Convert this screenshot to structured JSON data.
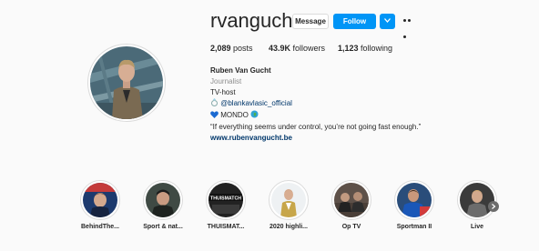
{
  "profile": {
    "username": "rvangucht",
    "buttons": {
      "message": "Message",
      "follow": "Follow"
    },
    "stats": {
      "posts_value": "2,089",
      "posts_label": "posts",
      "followers_value": "43.9K",
      "followers_label": "followers",
      "following_value": "1,123",
      "following_label": "following"
    },
    "bio": {
      "name": "Ruben Van Gucht",
      "category": "Journalist",
      "line1": "TV-host",
      "mention": "@blankavlasic_official",
      "line3": "MONDO",
      "quote": "“If everything seems under control, you’re not going fast enough.”",
      "link": "www.rubenvangucht.be"
    }
  },
  "highlights": [
    {
      "label": "BehindThe...",
      "icon": "highlight-behindthe"
    },
    {
      "label": "Sport & nat...",
      "icon": "highlight-sport"
    },
    {
      "label": "THUISMAT...",
      "icon": "highlight-thuismatch",
      "cover_text": "THUISMATCH"
    },
    {
      "label": "2020 highli...",
      "icon": "highlight-2020"
    },
    {
      "label": "Op TV",
      "icon": "highlight-optv"
    },
    {
      "label": "Sportman II",
      "icon": "highlight-sportman"
    },
    {
      "label": "Live",
      "icon": "highlight-live"
    }
  ],
  "colors": {
    "accent": "#0095f6",
    "link": "#00376b",
    "muted": "#8e8e8e",
    "text": "#262626"
  }
}
